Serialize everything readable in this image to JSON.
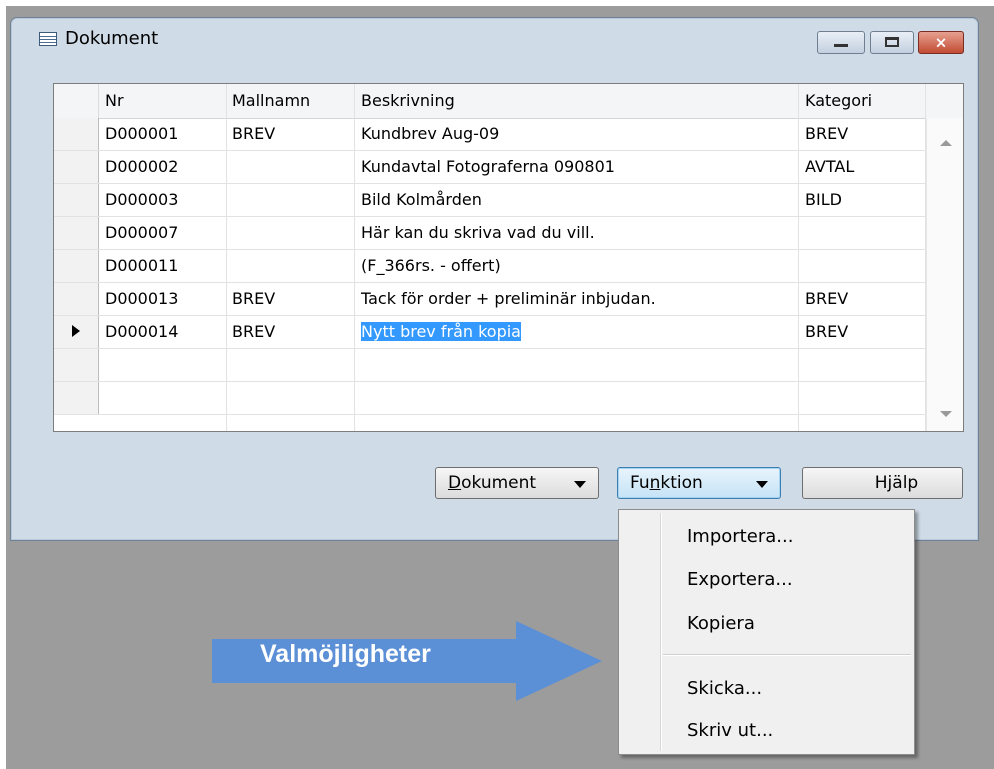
{
  "window": {
    "title": "Dokument",
    "controls": {
      "minimize": "minimize",
      "maximize": "maximize",
      "close": "×"
    }
  },
  "table": {
    "columns": [
      "Nr",
      "Mallnamn",
      "Beskrivning",
      "Kategori"
    ],
    "rows": [
      {
        "nr": "D000001",
        "mallnamn": "BREV",
        "beskrivning": "Kundbrev Aug-09",
        "kategori": "BREV"
      },
      {
        "nr": "D000002",
        "mallnamn": "",
        "beskrivning": "Kundavtal Fotograferna 090801",
        "kategori": "AVTAL"
      },
      {
        "nr": "D000003",
        "mallnamn": "",
        "beskrivning": "Bild Kolmården",
        "kategori": "BILD"
      },
      {
        "nr": "D000007",
        "mallnamn": "",
        "beskrivning": "Här kan du skriva vad du vill.",
        "kategori": ""
      },
      {
        "nr": "D000011",
        "mallnamn": "",
        "beskrivning": "(F_366rs. - offert)",
        "kategori": ""
      },
      {
        "nr": "D000013",
        "mallnamn": "BREV",
        "beskrivning": "Tack för order + preliminär inbjudan.",
        "kategori": "BREV"
      },
      {
        "nr": "D000014",
        "mallnamn": "BREV",
        "beskrivning": "Nytt brev från kopia",
        "kategori": "BREV",
        "current": true,
        "selected_field": "beskrivning"
      },
      {
        "nr": "",
        "mallnamn": "",
        "beskrivning": "",
        "kategori": ""
      },
      {
        "nr": "",
        "mallnamn": "",
        "beskrivning": "",
        "kategori": ""
      }
    ]
  },
  "buttons": {
    "dokument": {
      "pre": "",
      "ul": "D",
      "post": "okument"
    },
    "funktion": {
      "pre": "Fu",
      "ul": "n",
      "post": "ktion"
    },
    "hjalp": "Hjälp"
  },
  "menu": {
    "items": [
      "Importera...",
      "Exportera...",
      "Kopiera",
      "Skicka...",
      "Skriv ut..."
    ]
  },
  "callout": {
    "text": "Valmöjligheter",
    "color": "#5b8fd6"
  },
  "colors": {
    "selection": "#3399ff",
    "window_frame": "#cfdbe7",
    "desktop": "#9c9c9c"
  }
}
